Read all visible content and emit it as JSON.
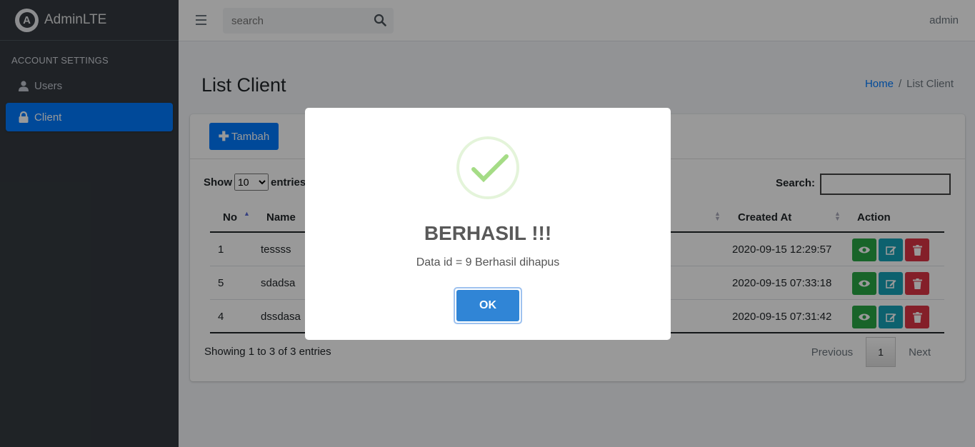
{
  "brand": {
    "logo_letter": "A",
    "name": "AdminLTE"
  },
  "sidebar": {
    "header": "ACCOUNT SETTINGS",
    "items": [
      {
        "label": "Users",
        "icon": "user-icon",
        "active": false
      },
      {
        "label": "Client",
        "icon": "lock-icon",
        "active": true
      }
    ]
  },
  "topbar": {
    "search_placeholder": "search",
    "user": "admin"
  },
  "page": {
    "title": "List Client"
  },
  "breadcrumb": {
    "home": "Home",
    "separator": "/",
    "current": "List Client"
  },
  "card": {
    "add_button": "Tambah",
    "show_label": "Show",
    "entries_label": "entries",
    "page_size": "10",
    "search_label": "Search:",
    "columns": [
      "No",
      "Name",
      "Created At",
      "Action"
    ],
    "rows": [
      {
        "no": "1",
        "name": "tessss",
        "created_at": "2020-09-15 12:29:57"
      },
      {
        "no": "5",
        "name": "sdadsa",
        "created_at": "2020-09-15 07:33:18"
      },
      {
        "no": "4",
        "name": "dssdasa",
        "created_at": "2020-09-15 07:31:42"
      }
    ],
    "info": "Showing 1 to 3 of 3 entries",
    "pagination": {
      "previous": "Previous",
      "page": "1",
      "next": "Next"
    }
  },
  "modal": {
    "title": "BERHASIL !!!",
    "text": "Data id = 9 Berhasil dihapus",
    "ok": "OK",
    "icon": "success-check-icon"
  },
  "colors": {
    "primary": "#007bff",
    "success": "#28a745",
    "info": "#17a2b8",
    "danger": "#dc3545",
    "sidebar": "#343a40",
    "confirm": "#3085d6"
  }
}
